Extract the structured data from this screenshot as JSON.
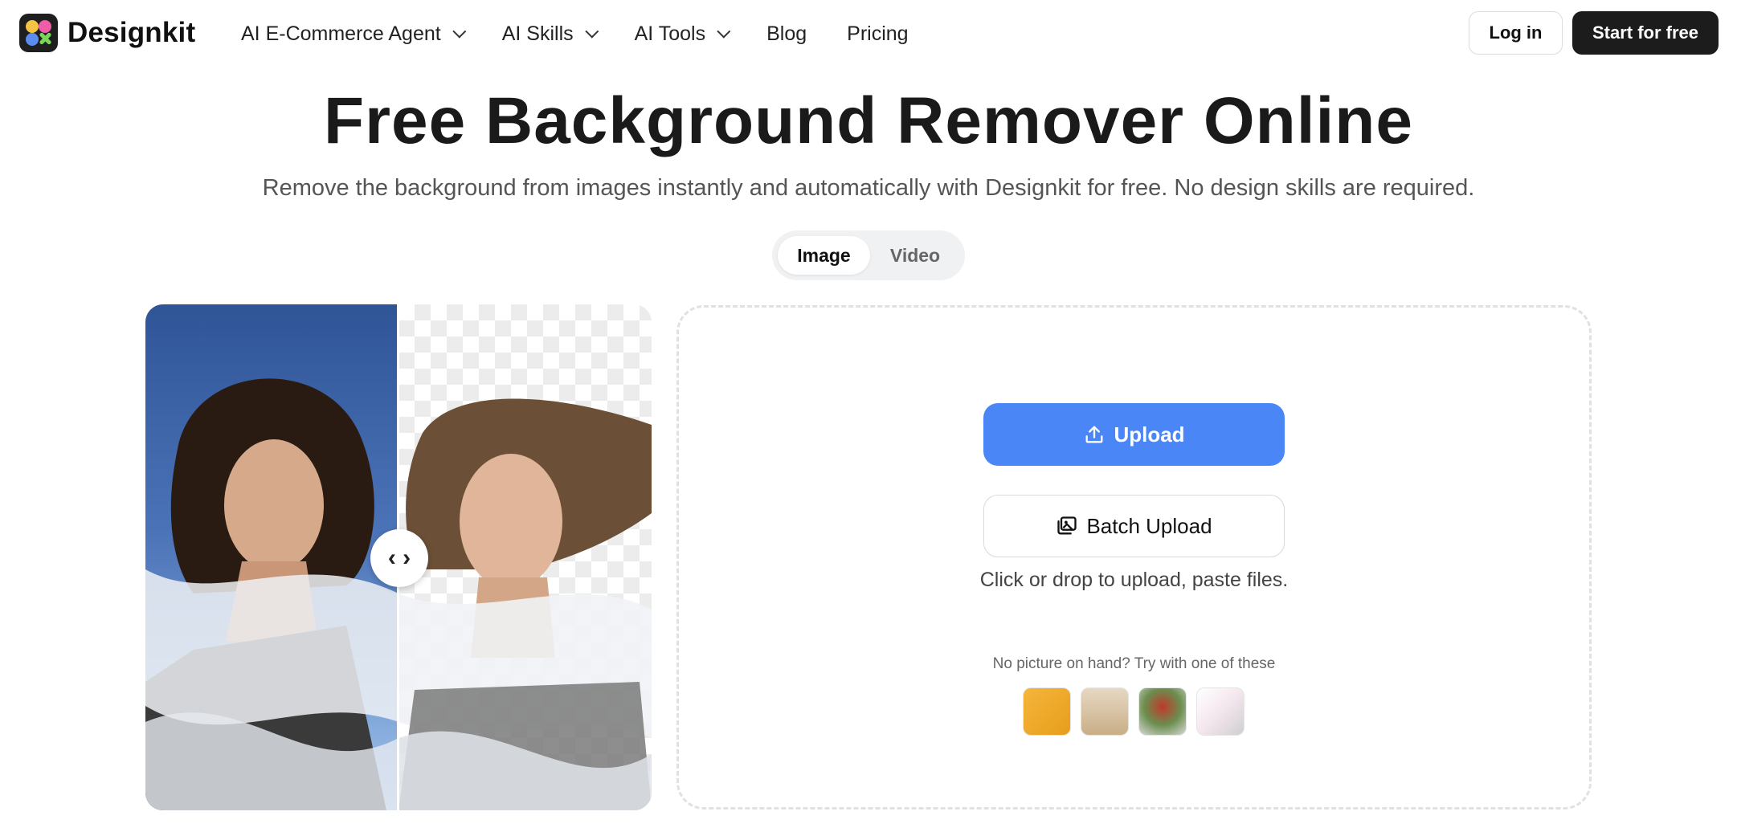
{
  "header": {
    "brand": "Designkit",
    "nav": [
      {
        "label": "AI E-Commerce Agent",
        "has_dropdown": true
      },
      {
        "label": "AI Skills",
        "has_dropdown": true
      },
      {
        "label": "AI Tools",
        "has_dropdown": true
      },
      {
        "label": "Blog",
        "has_dropdown": false
      },
      {
        "label": "Pricing",
        "has_dropdown": false
      }
    ],
    "login_label": "Log in",
    "start_label": "Start for free"
  },
  "hero": {
    "title": "Free Background Remover Online",
    "subtitle": "Remove the background from images instantly and automatically with Designkit for free. No design skills are required.",
    "tabs": [
      {
        "label": "Image",
        "active": true
      },
      {
        "label": "Video",
        "active": false
      }
    ]
  },
  "compare": {
    "handle_glyph": "‹ ›",
    "split_position": 0.5
  },
  "upload": {
    "upload_label": "Upload",
    "batch_label": "Batch Upload",
    "hint": "Click or drop to upload, paste files.",
    "try_label": "No picture on hand? Try with one of these",
    "samples": [
      "perfume-sample",
      "dress-sample",
      "flowers-sample",
      "fashion-sample"
    ]
  },
  "colors": {
    "primary": "#4a86f5",
    "dark_button": "#1c1c1c",
    "text": "#1a1a1a",
    "muted": "#555555"
  }
}
